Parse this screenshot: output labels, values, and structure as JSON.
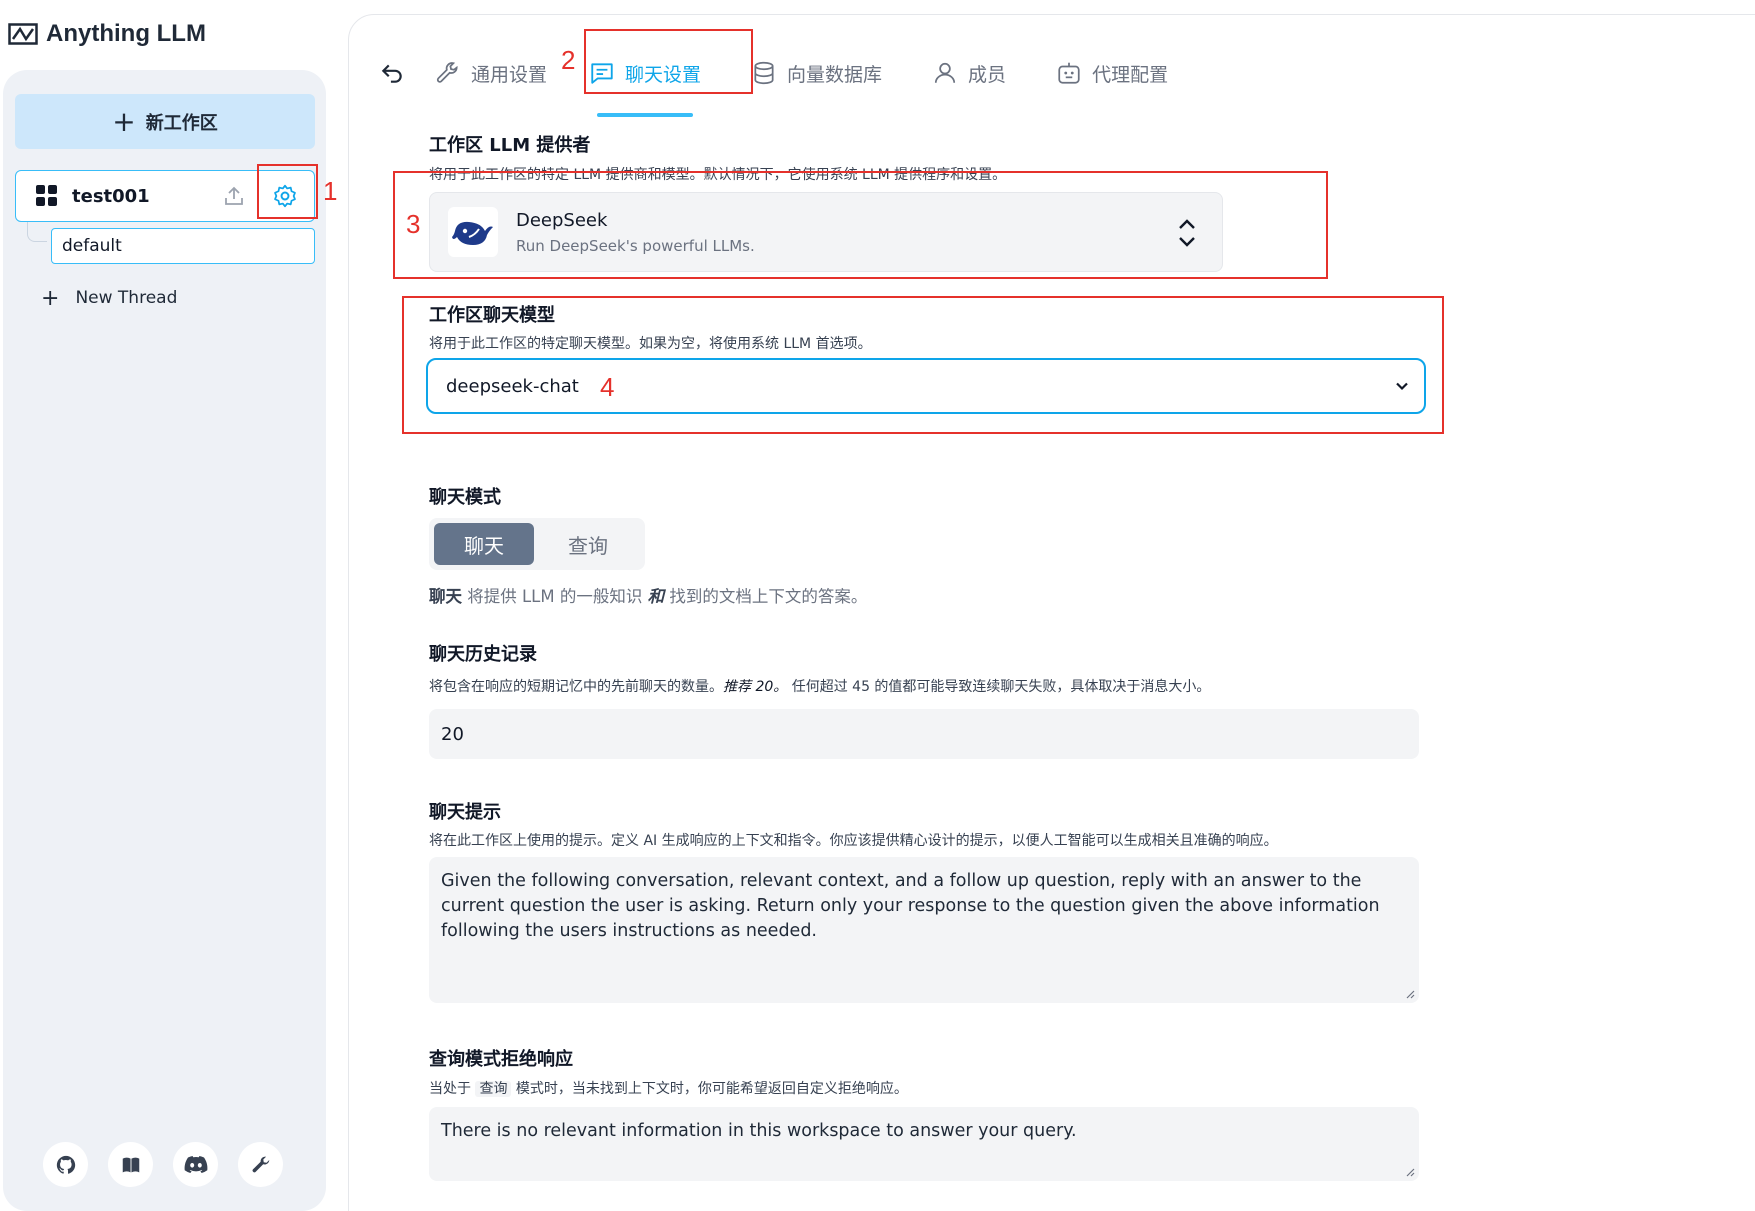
{
  "app": {
    "title": "Anything LLM"
  },
  "sidebar": {
    "new_workspace_label": "新工作区",
    "workspace": {
      "name": "test001"
    },
    "thread": {
      "name": "default"
    },
    "new_thread_label": "New Thread",
    "footer_icons": [
      "github-icon",
      "docs-book-icon",
      "discord-icon",
      "wrench-icon"
    ]
  },
  "tabs": [
    {
      "label": "通用设置",
      "icon": "wrench-icon"
    },
    {
      "label": "聊天设置",
      "icon": "chat-icon",
      "active": true
    },
    {
      "label": "向量数据库",
      "icon": "database-icon"
    },
    {
      "label": "成员",
      "icon": "user-icon"
    },
    {
      "label": "代理配置",
      "icon": "robot-icon"
    }
  ],
  "llm_provider": {
    "title": "工作区 LLM 提供者",
    "description": "将用于此工作区的特定 LLM 提供商和模型。默认情况下，它使用系统 LLM 提供程序和设置。",
    "selected_name": "DeepSeek",
    "selected_desc": "Run DeepSeek's powerful LLMs."
  },
  "chat_model": {
    "title": "工作区聊天模型",
    "description": "将用于此工作区的特定聊天模型。如果为空，将使用系统 LLM 首选项。",
    "value": "deepseek-chat"
  },
  "chat_mode": {
    "title": "聊天模式",
    "options": [
      "聊天",
      "查询"
    ],
    "selected": "聊天",
    "help_bold": "聊天",
    "help_pre": " 将提供 LLM 的一般知识 ",
    "help_italic": "和",
    "help_post": " 找到的文档上下文的答案。"
  },
  "chat_history": {
    "title": "聊天历史记录",
    "description_pre": "将包含在响应的短期记忆中的先前聊天的数量。",
    "description_em": "推荐 20。",
    "description_post": " 任何超过 45 的值都可能导致连续聊天失败，具体取决于消息大小。",
    "value": "20"
  },
  "chat_prompt": {
    "title": "聊天提示",
    "description": "将在此工作区上使用的提示。定义 AI 生成响应的上下文和指令。你应该提供精心设计的提示，以便人工智能可以生成相关且准确的响应。",
    "value": "Given the following conversation, relevant context, and a follow up question, reply with an answer to the current question the user is asking. Return only your response to the question given the above information following the users instructions as needed."
  },
  "query_refusal": {
    "title": "查询模式拒绝响应",
    "description_pre": "当处于",
    "description_code": "查询",
    "description_post": "模式时，当未找到上下文时，你可能希望返回自定义拒绝响应。",
    "value": "There is no relevant information in this workspace to answer your query."
  },
  "annotations": {
    "n1": "1",
    "n2": "2",
    "n3": "3",
    "n4": "4"
  },
  "colors": {
    "accent": "#0ea5e9",
    "annotation": "#e5312b"
  }
}
